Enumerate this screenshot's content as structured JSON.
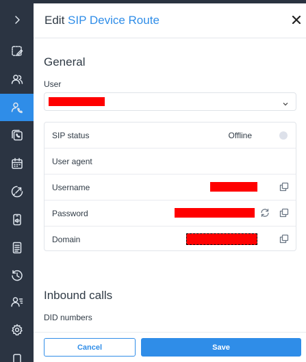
{
  "sidebar": {
    "items": [
      {
        "icon": "chevron-right-icon",
        "name": "sidebar-toggle"
      },
      {
        "icon": "edit-board-icon",
        "name": "sidebar-item-edit"
      },
      {
        "icon": "users-icon",
        "name": "sidebar-item-users"
      },
      {
        "icon": "user-phone-icon",
        "name": "sidebar-item-sip-routes",
        "active": true
      },
      {
        "icon": "phone-copy-icon",
        "name": "sidebar-item-calls"
      },
      {
        "icon": "calendar-icon",
        "name": "sidebar-item-calendar"
      },
      {
        "icon": "rocket-icon",
        "name": "sidebar-item-launch"
      },
      {
        "icon": "device-audio-icon",
        "name": "sidebar-item-devices"
      },
      {
        "icon": "document-icon",
        "name": "sidebar-item-documents"
      },
      {
        "icon": "history-icon",
        "name": "sidebar-item-history"
      },
      {
        "icon": "user-list-icon",
        "name": "sidebar-item-contacts"
      },
      {
        "icon": "gear-icon",
        "name": "sidebar-item-settings"
      },
      {
        "icon": "more-icon",
        "name": "sidebar-item-more"
      }
    ]
  },
  "panel": {
    "title_prefix": "Edit ",
    "title_accent": "SIP Device Route",
    "accent_color": "#2f8de8"
  },
  "general": {
    "heading": "General",
    "user_label": "User"
  },
  "info": {
    "sip_status_label": "SIP status",
    "sip_status_value": "Offline",
    "user_agent_label": "User agent",
    "username_label": "Username",
    "password_label": "Password",
    "domain_label": "Domain"
  },
  "inbound": {
    "heading": "Inbound calls",
    "did_label": "DID numbers"
  },
  "footer": {
    "cancel_label": "Cancel",
    "save_label": "Save"
  }
}
